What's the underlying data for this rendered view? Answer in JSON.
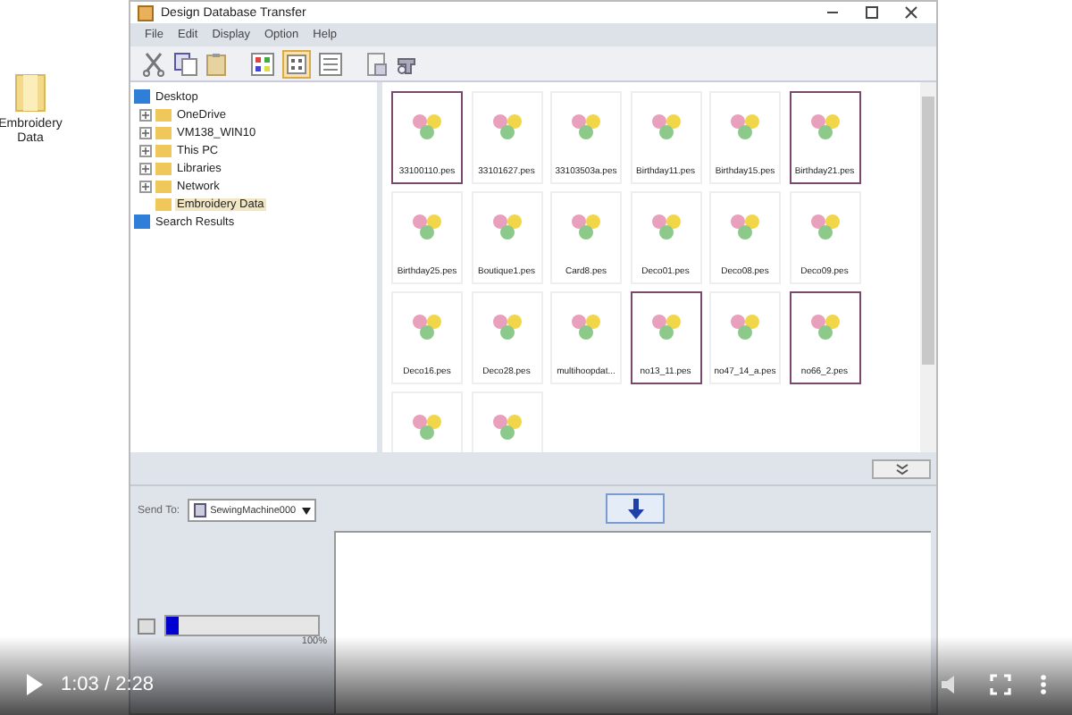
{
  "desktop_icon": {
    "label": "Embroidery Data"
  },
  "window": {
    "title": "Design Database Transfer"
  },
  "menu": [
    "File",
    "Edit",
    "Display",
    "Option",
    "Help"
  ],
  "tree": [
    {
      "label": "Desktop",
      "selected": false,
      "children": [
        {
          "label": "OneDrive",
          "selected": false,
          "expanded": false
        },
        {
          "label": "VM138_WIN10",
          "selected": false,
          "expanded": false
        },
        {
          "label": "This PC",
          "selected": false,
          "expanded": false
        },
        {
          "label": "Libraries",
          "selected": false,
          "expanded": false
        },
        {
          "label": "Network",
          "selected": false,
          "expanded": false
        },
        {
          "label": "Embroidery Data",
          "selected": true
        }
      ]
    },
    {
      "label": "Search Results",
      "selected": false
    }
  ],
  "designs": [
    {
      "label": "33100110.pes",
      "selected": true
    },
    {
      "label": "33101627.pes",
      "selected": false
    },
    {
      "label": "33103503a.pes",
      "selected": false
    },
    {
      "label": "Birthday11.pes",
      "selected": false
    },
    {
      "label": "Birthday15.pes",
      "selected": false
    },
    {
      "label": "Birthday21.pes",
      "selected": true
    },
    {
      "label": "Birthday25.pes",
      "selected": false
    },
    {
      "label": "Boutique1.pes",
      "selected": false
    },
    {
      "label": "Card8.pes",
      "selected": false
    },
    {
      "label": "Deco01.pes",
      "selected": false
    },
    {
      "label": "Deco08.pes",
      "selected": false
    },
    {
      "label": "Deco09.pes",
      "selected": false
    },
    {
      "label": "Deco16.pes",
      "selected": false
    },
    {
      "label": "Deco28.pes",
      "selected": false
    },
    {
      "label": "multihoopdat...",
      "selected": false
    },
    {
      "label": "no13_11.pes",
      "selected": true
    },
    {
      "label": "no47_14_a.pes",
      "selected": false
    },
    {
      "label": "no66_2.pes",
      "selected": true
    },
    {
      "selected": false
    },
    {
      "selected": false
    }
  ],
  "send_to": {
    "label": "Send To:",
    "value": "SewingMachine000"
  },
  "progress": {
    "level": 0.08,
    "reading": "100%"
  },
  "video": {
    "time": "1:03 / 2:28"
  }
}
